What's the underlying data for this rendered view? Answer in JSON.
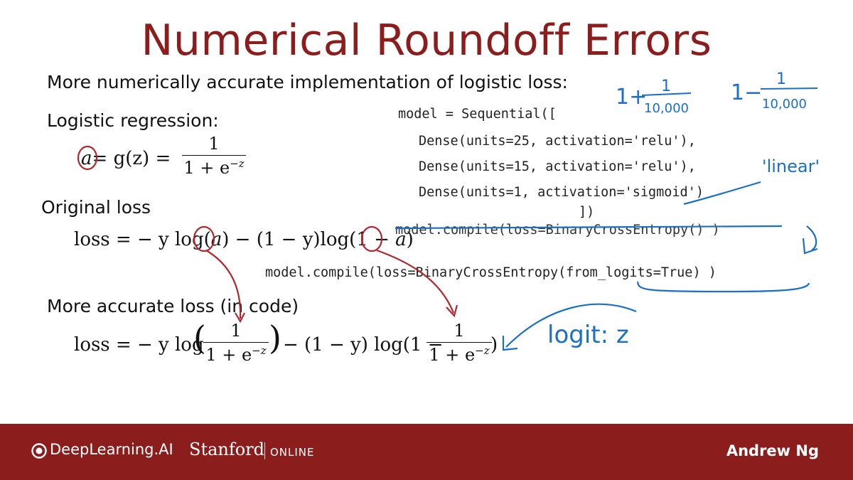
{
  "title": "Numerical Roundoff Errors",
  "intro": "More numerically accurate implementation of logistic loss:",
  "logistic": {
    "heading": "Logistic regression:",
    "lhs": "a",
    "mid": "= g(z) =",
    "num": "1",
    "den": "1 + e",
    "den_exp": "−z"
  },
  "original_loss": {
    "heading": "Original loss",
    "formula_a": "loss = − y log(",
    "a1": "a",
    "formula_b": ") − (1 − y)log(1 − ",
    "a2": "a",
    "formula_c": ")"
  },
  "accurate_loss": {
    "heading": "More accurate loss (in code)",
    "part1": "loss = − y log",
    "part2": "− (1 − y) log(1 −",
    "num": "1",
    "den": "1 + e",
    "den_exp": "−z",
    "close": ")"
  },
  "code": {
    "line1": "model = Sequential([",
    "line2": "Dense(units=25, activation='relu'),",
    "line3": "Dense(units=15, activation='relu'),",
    "line4": "Dense(units=1, activation='sigmoid')",
    "line5": "])",
    "line6": "model.compile(loss=BinaryCrossEntropy() )",
    "line7": "model.compile(loss=BinaryCrossEntropy(from_logits=True) )"
  },
  "handwriting": {
    "left_frac_prefix": "1+",
    "right_frac_prefix": "1−",
    "frac_num": "1",
    "frac_den": "10,000",
    "linear": "'linear'",
    "logit": "logit: z"
  },
  "colors": {
    "title": "#8c1d1d",
    "footer": "#8c1d1d",
    "ink_red": "#b3262b",
    "ink_blue": "#1a6fc9"
  },
  "footer": {
    "deeplearning": "DeepLearning.AI",
    "stanford": "Stanford",
    "online": "ONLINE",
    "author": "Andrew Ng"
  }
}
